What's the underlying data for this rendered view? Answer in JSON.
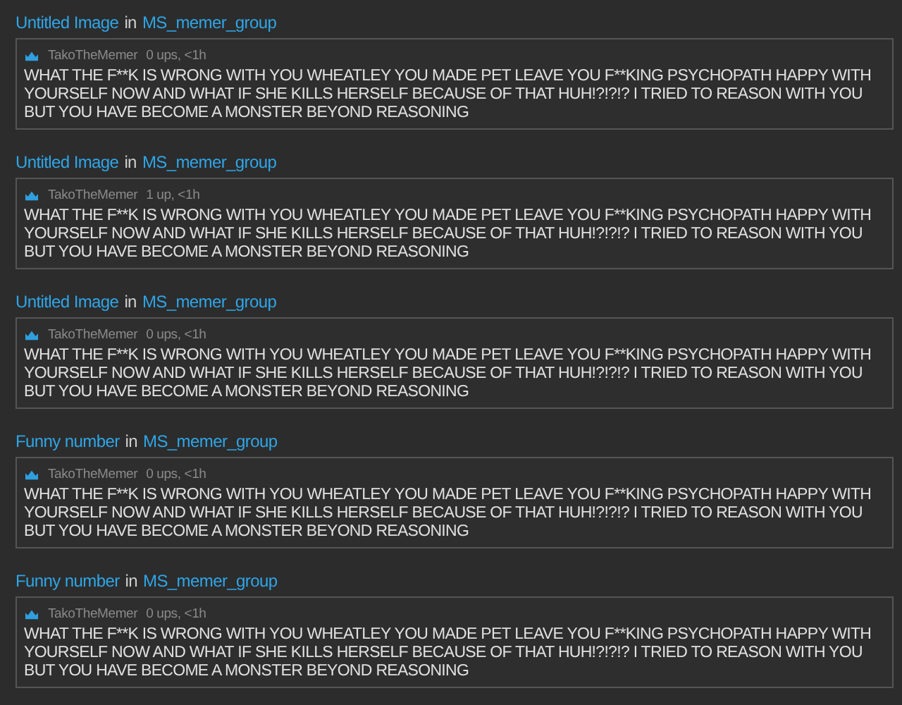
{
  "posts": [
    {
      "title": "Untitled Image",
      "joiner": "in",
      "group": "MS_memer_group",
      "author": "TakoTheMemer",
      "meta": "0 ups, <1h",
      "text": "WHAT THE F**K IS WRONG WITH YOU WHEATLEY YOU MADE PET LEAVE YOU F**KING PSYCHOPATH HAPPY WITH YOURSELF NOW AND WHAT IF SHE KILLS HERSELF BECAUSE OF THAT HUH!?!?!? I TRIED TO REASON WITH YOU BUT YOU HAVE BECOME A MONSTER BEYOND REASONING"
    },
    {
      "title": "Untitled Image",
      "joiner": "in",
      "group": "MS_memer_group",
      "author": "TakoTheMemer",
      "meta": "1 up, <1h",
      "text": "WHAT THE F**K IS WRONG WITH YOU WHEATLEY YOU MADE PET LEAVE YOU F**KING PSYCHOPATH HAPPY WITH YOURSELF NOW AND WHAT IF SHE KILLS HERSELF BECAUSE OF THAT HUH!?!?!? I TRIED TO REASON WITH YOU BUT YOU HAVE BECOME A MONSTER BEYOND REASONING"
    },
    {
      "title": "Untitled Image",
      "joiner": "in",
      "group": "MS_memer_group",
      "author": "TakoTheMemer",
      "meta": "0 ups, <1h",
      "text": "WHAT THE F**K IS WRONG WITH YOU WHEATLEY YOU MADE PET LEAVE YOU F**KING PSYCHOPATH HAPPY WITH YOURSELF NOW AND WHAT IF SHE KILLS HERSELF BECAUSE OF THAT HUH!?!?!? I TRIED TO REASON WITH YOU BUT YOU HAVE BECOME A MONSTER BEYOND REASONING"
    },
    {
      "title": "Funny number",
      "joiner": "in",
      "group": "MS_memer_group",
      "author": "TakoTheMemer",
      "meta": "0 ups, <1h",
      "text": "WHAT THE F**K IS WRONG WITH YOU WHEATLEY YOU MADE PET LEAVE YOU F**KING PSYCHOPATH HAPPY WITH YOURSELF NOW AND WHAT IF SHE KILLS HERSELF BECAUSE OF THAT HUH!?!?!? I TRIED TO REASON WITH YOU BUT YOU HAVE BECOME A MONSTER BEYOND REASONING"
    },
    {
      "title": "Funny number",
      "joiner": "in",
      "group": "MS_memer_group",
      "author": "TakoTheMemer",
      "meta": "0 ups, <1h",
      "text": "WHAT THE F**K IS WRONG WITH YOU WHEATLEY YOU MADE PET LEAVE YOU F**KING PSYCHOPATH HAPPY WITH YOURSELF NOW AND WHAT IF SHE KILLS HERSELF BECAUSE OF THAT HUH!?!?!? I TRIED TO REASON WITH YOU BUT YOU HAVE BECOME A MONSTER BEYOND REASONING"
    }
  ]
}
